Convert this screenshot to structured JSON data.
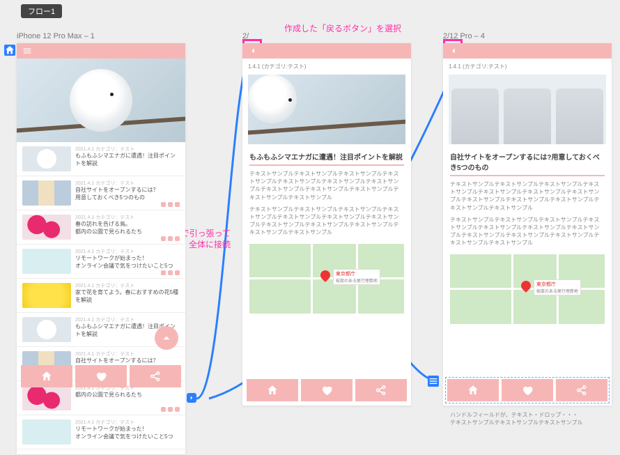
{
  "flow_label": "フロー1",
  "annotation_select_back": "作成した「戻るボタン」を選択",
  "annotation_drag_home_l1": "ホーム画面まで引っ張って",
  "annotation_drag_home_l2": "全体に接続",
  "artboards": {
    "a1": {
      "title": "iPhone 12 Pro Max – 1"
    },
    "a2": {
      "title": "2/",
      "crumb": "1.4.1 (カテゴリ:テスト)"
    },
    "a3": {
      "title": "2/12 Pro – 4",
      "crumb": "1.4.1 (カテゴリ:テスト)"
    }
  },
  "list": {
    "date": "2021.4.1 カテゴリ：テスト",
    "items": [
      {
        "t": "もふもふシマエナガに遭遇！注目ポイントを解説"
      },
      {
        "t": "自社サイトをオープンするには？",
        "t2": "用意しておくべき5つのもの"
      },
      {
        "t": "春の訪れを告げる鳥。",
        "t2": "都内の公園で見られるたち"
      },
      {
        "t": "リモートワークが始まった！",
        "t2": "オンライン会議で気をつけたいこと5つ"
      },
      {
        "t": "家で花を育てよう。春におすすめの花5種を解説"
      },
      {
        "t": "もふもふシマエナガに遭遇！注目ポイントを解説"
      },
      {
        "t": "自社サイトをオープンするには？"
      },
      {
        "t": "都内の公園で見られるたち"
      },
      {
        "t": "リモートワークが始まった！",
        "t2": "オンライン会議で気をつけたいこと5つ"
      }
    ]
  },
  "detail2": {
    "title": "もふもふシマエナガに遭遇！注目ポイントを解説",
    "para": "テキストサンプルテキストサンプルテキストサンプルテキストサンプルテキストサンプルテキストサンプルテキストサンプルテキストサンプルテキストサンプルテキストサンプルテキストサンプルテキストサンプル",
    "para2": "テキストサンプルテキストサンプルテキストサンプルテキストサンプルテキストサンプルテキストサンプルテキストサンプルテキストサンプルテキストサンプルテキストサンプルテキストサンプルテキストサンプル"
  },
  "detail3": {
    "title": "自社サイトをオープンするには?用意しておくべき5つのもの",
    "para": "テキストサンプルテキストサンプルテキストサンプルテキストサンプルテキストサンプルテキストサンプルテキストサンプルテキストサンプルテキストサンプルテキストサンプルテキストサンプルテキストサンプル",
    "para2": "テキストサンプルテキストサンプルテキストサンプルテキストサンプルテキストサンプルテキストサンプルテキストサンプルテキストサンプルテキストサンプルテキストサンプルテキストサンプルテキストサンプル",
    "cap1": "ハンドルフィールドが、テキスト・ドロップ・・・",
    "cap2": "テキストサンプルテキストサンプルテキストサンプル"
  },
  "map": {
    "pin_label": "東京都庁",
    "pin_sub": "桜度のある尾行埋葬地"
  }
}
